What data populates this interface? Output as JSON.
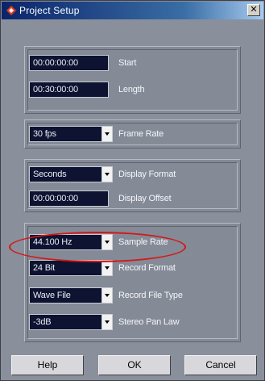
{
  "window": {
    "title": "Project Setup",
    "close_glyph": "✕"
  },
  "group1": {
    "start": {
      "value": "00:00:00:00",
      "label": "Start"
    },
    "length": {
      "value": "00:30:00:00",
      "label": "Length"
    }
  },
  "group2": {
    "frame_rate": {
      "value": "30 fps",
      "label": "Frame Rate"
    }
  },
  "group3": {
    "display_format": {
      "value": "Seconds",
      "label": "Display Format"
    },
    "display_offset": {
      "value": "00:00:00:00",
      "label": "Display Offset"
    }
  },
  "group4": {
    "sample_rate": {
      "value": "44.100 Hz",
      "label": "Sample Rate"
    },
    "record_format": {
      "value": "24 Bit",
      "label": "Record Format"
    },
    "record_file_type": {
      "value": "Wave File",
      "label": "Record File Type"
    },
    "stereo_pan_law": {
      "value": "-3dB",
      "label": "Stereo Pan Law"
    }
  },
  "buttons": {
    "help": "Help",
    "ok": "OK",
    "cancel": "Cancel"
  },
  "colors": {
    "title_start": "#0a246a",
    "title_end": "#a6caf0",
    "dialog_bg": "#8a8f9c",
    "field_bg": "#0d1330",
    "annotation_red": "#d41818"
  },
  "icons": {
    "app": "cubase-diamond-icon",
    "dropdown": "chevron-down-icon"
  }
}
